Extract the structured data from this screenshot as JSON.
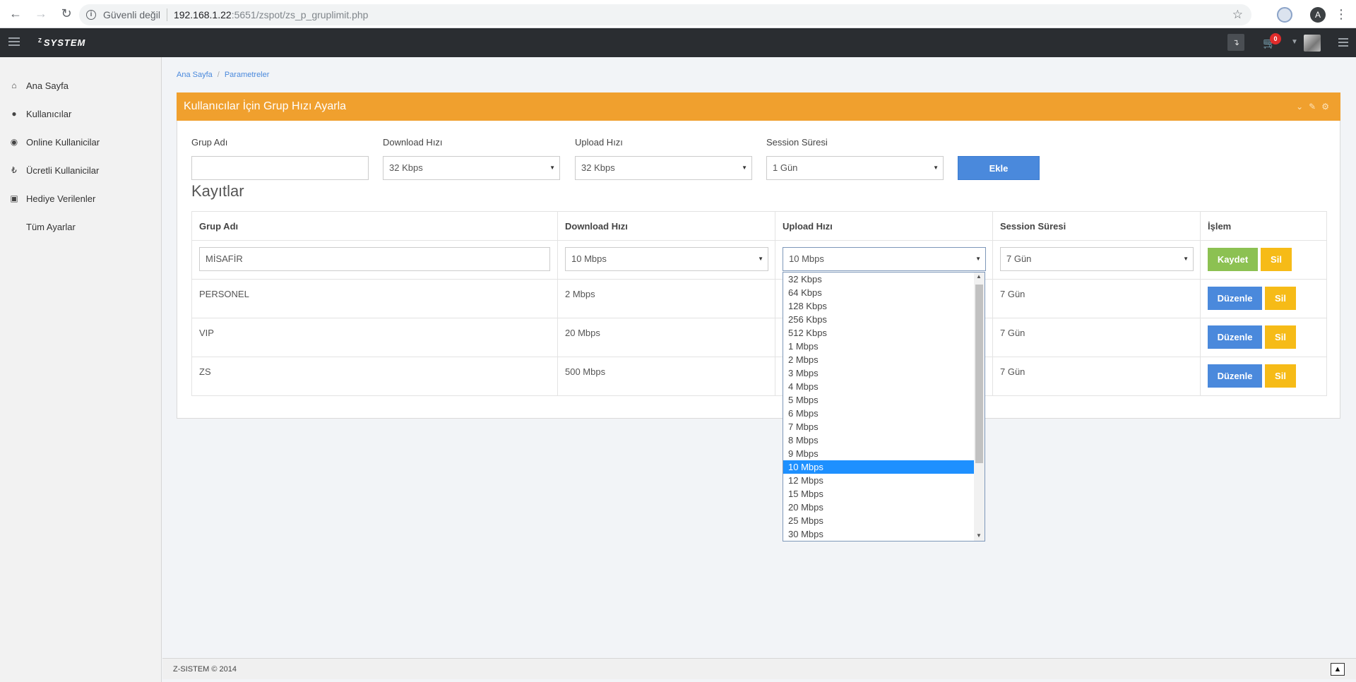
{
  "browser": {
    "insecure_label": "Güvenli değil",
    "url_host": "192.168.1.22",
    "url_rest": ":5651/zspot/zs_p_gruplimit.php",
    "profile_initial": "A"
  },
  "navbar": {
    "logo_prefix": "Z",
    "logo_text": "SYSTEM",
    "cart_count": "0"
  },
  "sidebar": {
    "items": [
      {
        "icon": "home-icon",
        "glyph": "⌂",
        "label": "Ana Sayfa"
      },
      {
        "icon": "user-icon",
        "glyph": "●",
        "label": "Kullanıcılar"
      },
      {
        "icon": "circle-dot-icon",
        "glyph": "◉",
        "label": "Online Kullanicilar"
      },
      {
        "icon": "lira-icon",
        "glyph": "₺",
        "label": "Ücretli Kullanicilar"
      },
      {
        "icon": "gift-icon",
        "glyph": "▣",
        "label": "Hediye Verilenler"
      },
      {
        "icon": "",
        "glyph": "",
        "label": "Tüm Ayarlar"
      }
    ]
  },
  "breadcrumb": {
    "home": "Ana Sayfa",
    "separator": "/",
    "current": "Parametreler"
  },
  "panel": {
    "title": "Kullanıcılar İçin Grup Hızı Ayarla"
  },
  "form": {
    "group_name_label": "Grup Adı",
    "group_name_value": "",
    "download_label": "Download Hızı",
    "download_value": "32 Kbps",
    "upload_label": "Upload Hızı",
    "upload_value": "32 Kbps",
    "session_label": "Session Süresi",
    "session_value": "1 Gün",
    "add_button": "Ekle"
  },
  "records": {
    "title": "Kayıtlar",
    "headers": [
      "Grup Adı",
      "Download Hızı",
      "Upload Hızı",
      "Session Süresi",
      "İşlem"
    ],
    "edit_row": {
      "name": "MİSAFİR",
      "download": "10 Mbps",
      "upload": "10 Mbps",
      "session": "7 Gün",
      "save_label": "Kaydet",
      "delete_label": "Sil"
    },
    "rows": [
      {
        "name": "PERSONEL",
        "download": "2 Mbps",
        "session": "7 Gün",
        "edit_label": "Düzenle",
        "delete_label": "Sil"
      },
      {
        "name": "VIP",
        "download": "20 Mbps",
        "session": "7 Gün",
        "edit_label": "Düzenle",
        "delete_label": "Sil"
      },
      {
        "name": "ZS",
        "download": "500 Mbps",
        "session": "7 Gün",
        "edit_label": "Düzenle",
        "delete_label": "Sil"
      }
    ]
  },
  "upload_dropdown": {
    "selected": "10 Mbps",
    "options": [
      "32 Kbps",
      "64 Kbps",
      "128 Kbps",
      "256 Kbps",
      "512 Kbps",
      "1 Mbps",
      "2 Mbps",
      "3 Mbps",
      "4 Mbps",
      "5 Mbps",
      "6 Mbps",
      "7 Mbps",
      "8 Mbps",
      "9 Mbps",
      "10 Mbps",
      "12 Mbps",
      "15 Mbps",
      "20 Mbps",
      "25 Mbps",
      "30 Mbps"
    ]
  },
  "footer": {
    "copyright": "Z-SISTEM © 2014"
  },
  "colors": {
    "panel_header": "#f0a02e",
    "primary": "#4a89dc",
    "success": "#8cc152",
    "warning": "#f6bb17",
    "navbar": "#2a2d31",
    "dropdown_selected": "#1e90ff"
  }
}
